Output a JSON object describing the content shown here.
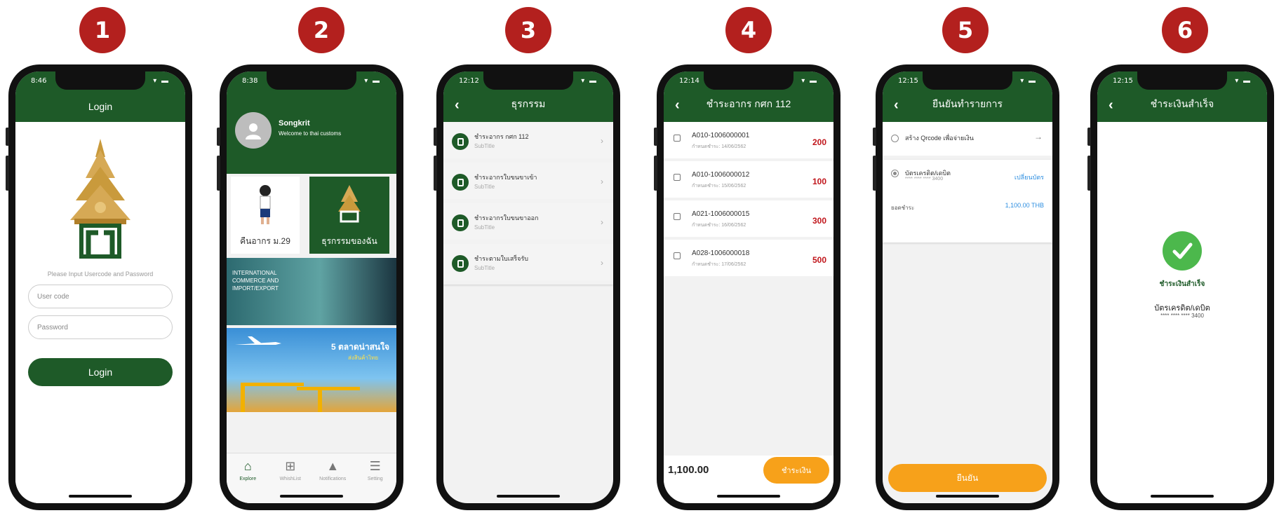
{
  "steps": [
    "1",
    "2",
    "3",
    "4",
    "5",
    "6"
  ],
  "colors": {
    "primary": "#1e5a28",
    "badge": "#b3201e",
    "accent": "#f7a11a",
    "amount_red": "#c0151b",
    "link_blue": "#2d8ee0",
    "success": "#4cb84c"
  },
  "screen1": {
    "time": "8:46",
    "title": "Login",
    "hint": "Please Input Usercode and Password",
    "user_placeholder": "User code",
    "password_placeholder": "Password",
    "login_button": "Login"
  },
  "screen2": {
    "time": "8:38",
    "profile_name": "Songkrit",
    "profile_sub": "Welcome to thai customs",
    "tile1_label": "คืนอากร ม.29",
    "tile2_label": "ธุรกรรมของฉัน",
    "banner1_text": "INTERNATIONAL COMMERCE AND IMPORT/EXPORT",
    "banner2_text": "5 ตลาดน่าสนใจ",
    "banner2_sub": "ส่งสินค้าไทย",
    "tabs": [
      {
        "label": "Explore",
        "icon": "home-icon"
      },
      {
        "label": "WhishList",
        "icon": "plus-icon"
      },
      {
        "label": "Notifications",
        "icon": "bell-icon"
      },
      {
        "label": "Setting",
        "icon": "menu-icon"
      }
    ]
  },
  "screen3": {
    "time": "12:12",
    "title": "ธุรกรรม",
    "items": [
      {
        "title": "ชำระอากร กศก 112",
        "sub": "SubTitle"
      },
      {
        "title": "ชำระอากรใบขนขาเข้า",
        "sub": "SubTitle"
      },
      {
        "title": "ชำระอากรใบขนขาออก",
        "sub": "SubTitle"
      },
      {
        "title": "ชำระตามใบเสร็จรับ",
        "sub": "SubTitle"
      }
    ]
  },
  "screen4": {
    "time": "12:14",
    "title": "ชำระอากร กศก 112",
    "bills": [
      {
        "code": "A010-1006000001",
        "due": "กำหนดชำระ: 14/06/2562",
        "amount": "200"
      },
      {
        "code": "A010-1006000012",
        "due": "กำหนดชำระ: 15/06/2562",
        "amount": "100"
      },
      {
        "code": "A021-1006000015",
        "due": "กำหนดชำระ: 16/06/2562",
        "amount": "300"
      },
      {
        "code": "A028-1006000018",
        "due": "กำหนดชำระ: 17/06/2562",
        "amount": "500"
      }
    ],
    "total": "1,100.00",
    "pay_button": "ชำระเงิน"
  },
  "screen5": {
    "time": "12:15",
    "title": "ยืนยันทำรายการ",
    "qr_option": "สร้าง Qrcode เพื่อจ่ายเงิน",
    "card_option": "บัตรเครดิต/เดบิต",
    "card_number": "**** **** **** 3400",
    "change_card": "เปลี่ยนบัตร",
    "total_label": "ยอดชำระ",
    "total_value": "1,100.00 THB",
    "confirm_button": "ยืนยัน"
  },
  "screen6": {
    "time": "12:15",
    "title": "ชำระเงินสำเร็จ",
    "success_label": "ชำระเงินสำเร็จ",
    "card_label": "บัตรเครดิต/เดบิต",
    "card_number": "**** **** **** 3400"
  }
}
